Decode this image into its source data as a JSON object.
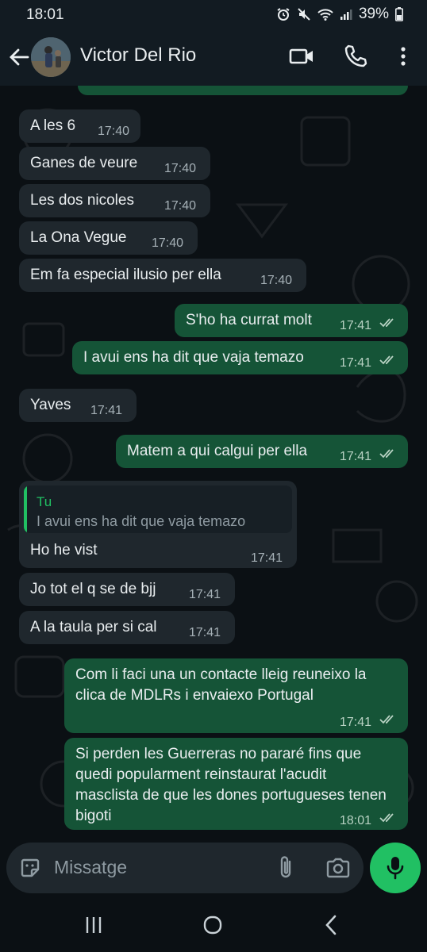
{
  "status_bar": {
    "time": "18:01",
    "battery": "39%"
  },
  "header": {
    "contact_name": "Victor Del Rio",
    "icons": [
      "back-arrow-icon",
      "video-call-icon",
      "phone-icon",
      "more-vert-icon"
    ]
  },
  "messages": [
    {
      "dir": "in",
      "text": "A les 6",
      "time": "17:40"
    },
    {
      "dir": "in",
      "text": "Ganes de veure",
      "time": "17:40"
    },
    {
      "dir": "in",
      "text": "Les dos nicoles",
      "time": "17:40"
    },
    {
      "dir": "in",
      "text": "La Ona Vegue",
      "time": "17:40"
    },
    {
      "dir": "in",
      "text": "Em fa especial ilusio per ella",
      "time": "17:40"
    },
    {
      "dir": "out",
      "text": "S'ho ha currat molt",
      "time": "17:41",
      "status": "read"
    },
    {
      "dir": "out",
      "text": "I avui ens ha dit que vaja temazo",
      "time": "17:41",
      "status": "read"
    },
    {
      "dir": "in",
      "text": "Yaves",
      "time": "17:41"
    },
    {
      "dir": "out",
      "text": "Matem a qui calgui per ella",
      "time": "17:41",
      "status": "read"
    },
    {
      "dir": "in",
      "quote_author": "Tu",
      "quote_text": "I avui ens ha dit que vaja temazo",
      "text": "Ho he vist",
      "time": "17:41"
    },
    {
      "dir": "in",
      "text": "Jo tot el q se de bjj",
      "time": "17:41"
    },
    {
      "dir": "in",
      "text": "A la taula per si cal",
      "time": "17:41"
    },
    {
      "dir": "out",
      "text": "Com li faci una un contacte lleig reuneixo la clica de MDLRs i envaiexo Portugal",
      "time": "17:41",
      "status": "read"
    },
    {
      "dir": "out",
      "text": "Si perden les Guerreras no pararé fins que quedi popularment reinstaurat l'acudit masclista de que les dones portugueses tenen bigoti",
      "time": "18:01",
      "status": "read"
    }
  ],
  "composer": {
    "placeholder": "Missatge",
    "icons": [
      "sticker-icon",
      "attach-icon",
      "camera-icon",
      "mic-icon"
    ]
  },
  "colors": {
    "incoming_bubble": "#1f272d",
    "outgoing_bubble": "#155437",
    "accent": "#21c063",
    "background": "#0b1014"
  }
}
